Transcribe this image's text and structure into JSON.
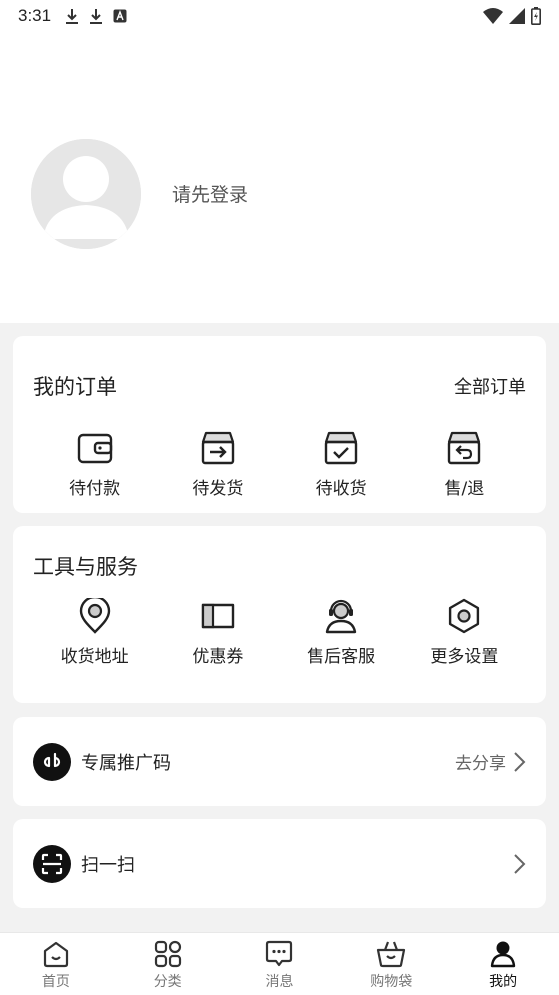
{
  "status_bar": {
    "time": "3:31",
    "icons": [
      "download-icon",
      "download-icon",
      "a-icon",
      "wifi-icon",
      "signal-icon",
      "battery-icon"
    ]
  },
  "profile": {
    "login_prompt": "请先登录"
  },
  "orders": {
    "title": "我的订单",
    "all_link": "全部订单",
    "items": [
      {
        "label": "待付款",
        "icon": "wallet-icon"
      },
      {
        "label": "待发货",
        "icon": "box-ship-icon"
      },
      {
        "label": "待收货",
        "icon": "box-check-icon"
      },
      {
        "label": "售/退",
        "icon": "box-return-icon"
      }
    ]
  },
  "tools": {
    "title": "工具与服务",
    "items": [
      {
        "label": "收货地址",
        "icon": "location-icon"
      },
      {
        "label": "优惠券",
        "icon": "coupon-icon"
      },
      {
        "label": "售后客服",
        "icon": "headset-icon"
      },
      {
        "label": "更多设置",
        "icon": "gear-icon"
      }
    ]
  },
  "promo": {
    "label": "专属推广码",
    "action": "去分享"
  },
  "scan": {
    "label": "扫一扫"
  },
  "tabbar": {
    "items": [
      {
        "label": "首页",
        "icon": "home-icon"
      },
      {
        "label": "分类",
        "icon": "category-icon"
      },
      {
        "label": "消息",
        "icon": "message-icon"
      },
      {
        "label": "购物袋",
        "icon": "basket-icon"
      },
      {
        "label": "我的",
        "icon": "user-icon",
        "active": true
      }
    ]
  }
}
